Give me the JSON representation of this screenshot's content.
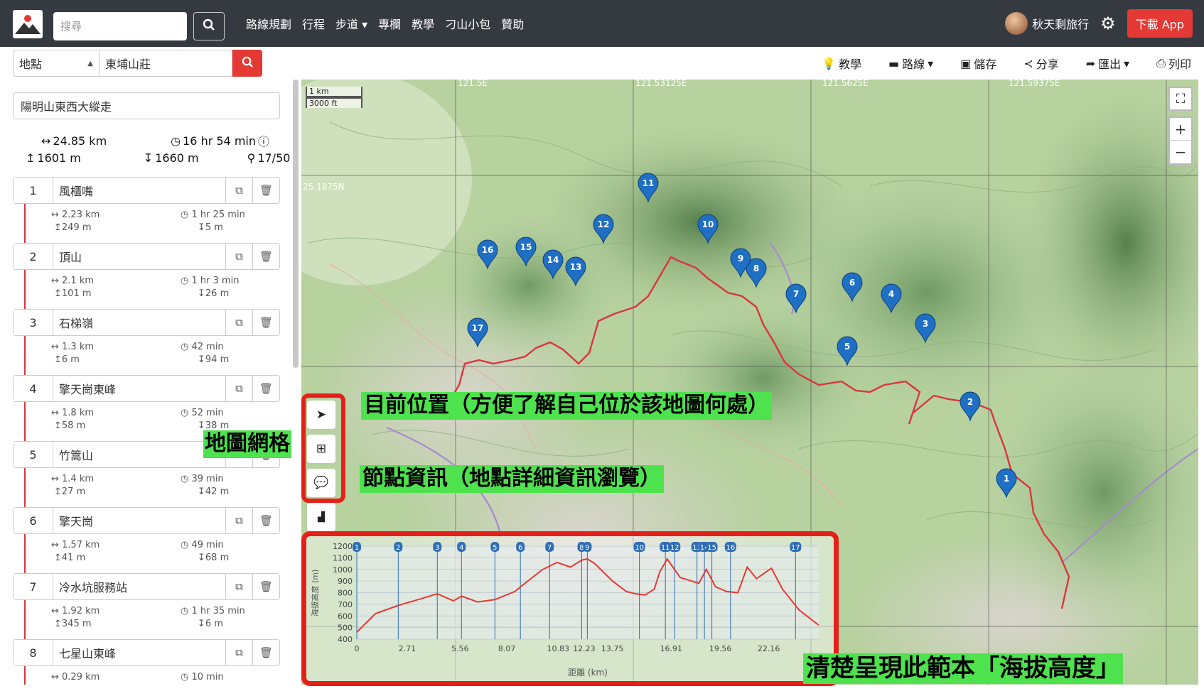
{
  "navbar": {
    "search_placeholder": "搜尋",
    "menu": [
      "路線規劃",
      "行程",
      "步道 ▾",
      "專欄",
      "教學",
      "刁山小包",
      "贊助"
    ],
    "user_name": "秋天剩旅行",
    "download_label": "下載 App"
  },
  "location_search": {
    "type_label": "地點",
    "query": "東埔山莊"
  },
  "toolbar": {
    "tutorial": "教學",
    "route": "路線",
    "save": "儲存",
    "share": "分享",
    "export": "匯出",
    "print": "列印"
  },
  "route": {
    "name": "陽明山東西大縱走",
    "distance": "24.85 km",
    "time": "16 hr 54 min",
    "ascent": "1601 m",
    "descent": "1660 m",
    "points": "17/50"
  },
  "waypoints": [
    {
      "num": "1",
      "name": "風櫃嘴",
      "dist": "2.23 km",
      "time": "1 hr 25 min",
      "up": "249 m",
      "down": "5 m"
    },
    {
      "num": "2",
      "name": "頂山",
      "dist": "2.1 km",
      "time": "1 hr 3 min",
      "up": "101 m",
      "down": "26 m"
    },
    {
      "num": "3",
      "name": "石梯嶺",
      "dist": "1.3 km",
      "time": "42 min",
      "up": "6 m",
      "down": "94 m"
    },
    {
      "num": "4",
      "name": "擎天崗東峰",
      "dist": "1.8 km",
      "time": "52 min",
      "up": "58 m",
      "down": "38 m"
    },
    {
      "num": "5",
      "name": "竹篙山",
      "dist": "1.4 km",
      "time": "39 min",
      "up": "27 m",
      "down": "42 m"
    },
    {
      "num": "6",
      "name": "擎天崗",
      "dist": "1.57 km",
      "time": "49 min",
      "up": "41 m",
      "down": "68 m"
    },
    {
      "num": "7",
      "name": "冷水坑服務站",
      "dist": "1.92 km",
      "time": "1 hr 35 min",
      "up": "345 m",
      "down": "6 m"
    },
    {
      "num": "8",
      "name": "七星山東峰",
      "dist": "0.29 km",
      "time": "10 min",
      "up": "",
      "down": ""
    }
  ],
  "map": {
    "lon_labels": [
      "121.5E",
      "121.53125E",
      "121.5625E",
      "121.59375E"
    ],
    "lat_label": "25.1875N",
    "scale_km": "1 km",
    "scale_ft": "3000 ft",
    "markers": [
      {
        "n": "1"
      },
      {
        "n": "2"
      },
      {
        "n": "3"
      },
      {
        "n": "4"
      },
      {
        "n": "5"
      },
      {
        "n": "6"
      },
      {
        "n": "7"
      },
      {
        "n": "8"
      },
      {
        "n": "9"
      },
      {
        "n": "10"
      },
      {
        "n": "11"
      },
      {
        "n": "12"
      },
      {
        "n": "13"
      },
      {
        "n": "14"
      },
      {
        "n": "15"
      },
      {
        "n": "16"
      },
      {
        "n": "17"
      }
    ]
  },
  "elevation": {
    "y_label": "海拔高度 (m)",
    "x_label": "距離 (km)",
    "y_ticks": [
      "1200",
      "1100",
      "1000",
      "900",
      "800",
      "700",
      "600",
      "500",
      "400"
    ],
    "x_ticks": [
      "0",
      "2.71",
      "5.56",
      "8.07",
      "10.83",
      "12.23",
      "13.75",
      "16.91",
      "19.56",
      "22.16"
    ],
    "markers": [
      "1",
      "2",
      "3",
      "4",
      "5",
      "6",
      "7",
      "8",
      "9",
      "10",
      "11",
      "12",
      "13",
      "14",
      "15",
      "16",
      "17"
    ]
  },
  "annotations": {
    "grid": "地圖網格",
    "location": "目前位置（方便了解自己位於該地圖何處）",
    "node_info": "節點資訊（地點詳細資訊瀏覽）",
    "elevation": "清楚呈現此範本「海拔高度」"
  },
  "colors": {
    "accent": "#e53935",
    "route": "#d9363e",
    "annotation_bg": "#4ee24e",
    "marker": "#1f6fc5"
  },
  "chart_data": {
    "type": "area",
    "title": "",
    "xlabel": "距離 (km)",
    "ylabel": "海拔高度 (m)",
    "ylim": [
      400,
      1200
    ],
    "x": [
      0,
      1,
      2.23,
      3.5,
      4.33,
      5.2,
      5.63,
      6.5,
      7.43,
      8.5,
      9.2,
      10.0,
      10.77,
      11.5,
      12.1,
      12.4,
      12.8,
      13.75,
      14.5,
      15.0,
      15.5,
      16.0,
      16.3,
      16.7,
      17.0,
      17.4,
      18.0,
      18.4,
      18.8,
      19.3,
      19.9,
      20.5,
      21.0,
      21.5,
      22.3,
      22.9,
      23.8,
      24.85
    ],
    "values": [
      460,
      620,
      690,
      750,
      790,
      730,
      770,
      720,
      740,
      810,
      900,
      1000,
      1060,
      1020,
      1080,
      1090,
      1050,
      900,
      810,
      790,
      780,
      830,
      980,
      1090,
      1020,
      930,
      900,
      880,
      1000,
      850,
      810,
      800,
      1020,
      920,
      1010,
      830,
      650,
      520
    ]
  }
}
